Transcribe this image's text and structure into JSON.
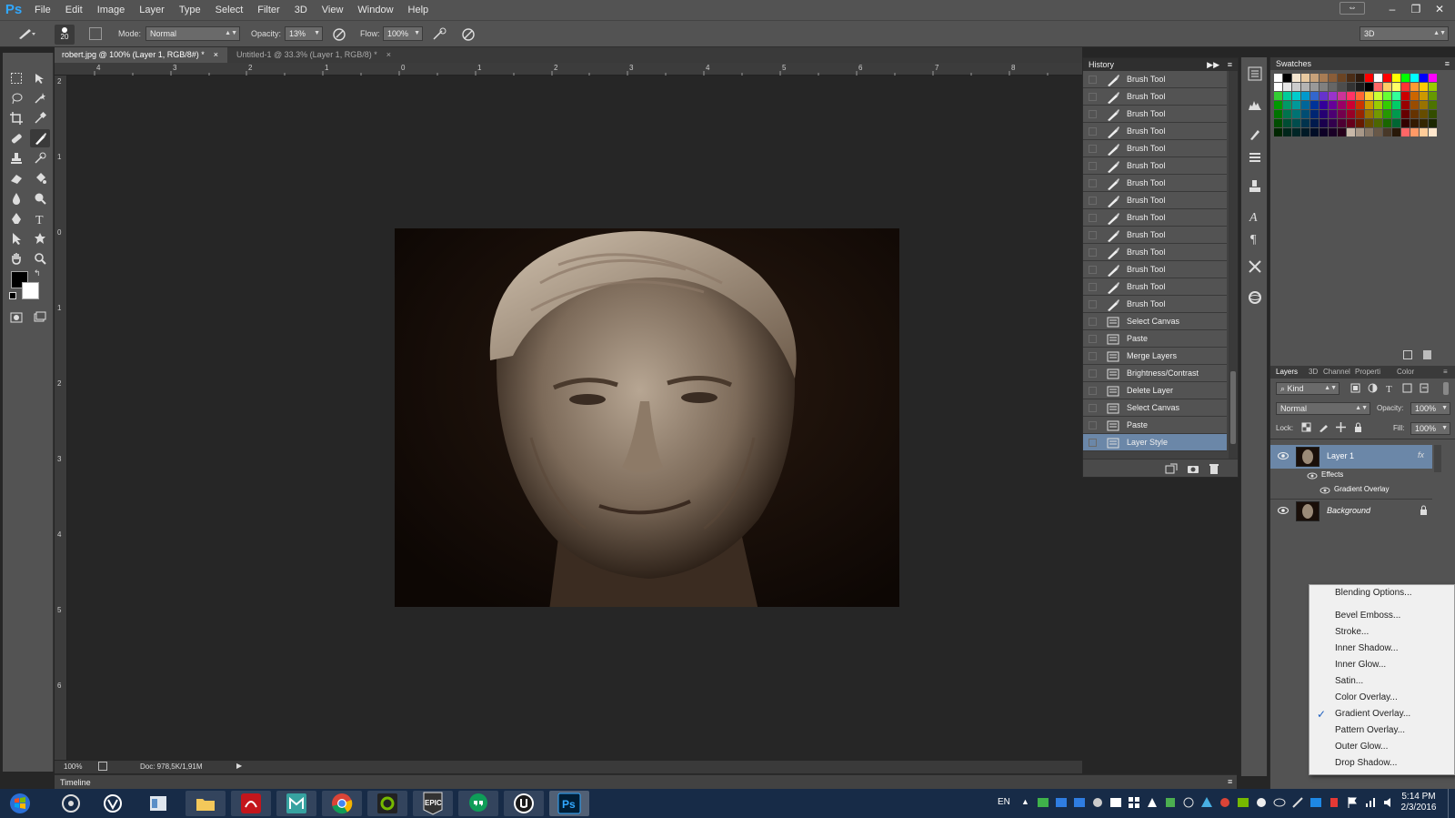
{
  "app": {
    "logo": "Ps"
  },
  "menu": [
    "File",
    "Edit",
    "Image",
    "Layer",
    "Type",
    "Select",
    "Filter",
    "3D",
    "View",
    "Window",
    "Help"
  ],
  "options": {
    "brush_size": "20",
    "mode_label": "Mode:",
    "mode_value": "Normal",
    "opacity_label": "Opacity:",
    "opacity_value": "13%",
    "flow_label": "Flow:",
    "flow_value": "100%",
    "workspace": "3D"
  },
  "tabs": [
    {
      "title": "robert.jpg @ 100% (Layer 1, RGB/8#) *",
      "close": "×"
    },
    {
      "title": "Untitled-1 @ 33.3% (Layer 1, RGB/8) *",
      "close": "×"
    }
  ],
  "ruler": {
    "h": [
      "4",
      "3",
      "2",
      "1",
      "0",
      "1",
      "2",
      "3",
      "4",
      "5",
      "6",
      "7",
      "8"
    ],
    "v": [
      "2",
      "1",
      "0",
      "1",
      "2",
      "3",
      "4",
      "5",
      "6"
    ]
  },
  "status": {
    "zoom": "100%",
    "doc": "Doc: 978,5K/1,91M"
  },
  "timeline": {
    "label": "Timeline"
  },
  "history": {
    "title": "History",
    "items": [
      {
        "label": "Brush Tool",
        "icon": "brush-icon"
      },
      {
        "label": "Brush Tool",
        "icon": "brush-icon"
      },
      {
        "label": "Brush Tool",
        "icon": "brush-icon"
      },
      {
        "label": "Brush Tool",
        "icon": "brush-icon"
      },
      {
        "label": "Brush Tool",
        "icon": "brush-icon"
      },
      {
        "label": "Brush Tool",
        "icon": "brush-icon"
      },
      {
        "label": "Brush Tool",
        "icon": "brush-icon"
      },
      {
        "label": "Brush Tool",
        "icon": "brush-icon"
      },
      {
        "label": "Brush Tool",
        "icon": "brush-icon"
      },
      {
        "label": "Brush Tool",
        "icon": "brush-icon"
      },
      {
        "label": "Brush Tool",
        "icon": "brush-icon"
      },
      {
        "label": "Brush Tool",
        "icon": "brush-icon"
      },
      {
        "label": "Brush Tool",
        "icon": "brush-icon"
      },
      {
        "label": "Brush Tool",
        "icon": "brush-icon"
      },
      {
        "label": "Select Canvas",
        "icon": "document-icon"
      },
      {
        "label": "Paste",
        "icon": "document-icon"
      },
      {
        "label": "Merge Layers",
        "icon": "document-icon"
      },
      {
        "label": "Brightness/Contrast",
        "icon": "document-icon"
      },
      {
        "label": "Delete Layer",
        "icon": "document-icon"
      },
      {
        "label": "Select Canvas",
        "icon": "document-icon"
      },
      {
        "label": "Paste",
        "icon": "document-icon"
      },
      {
        "label": "Layer Style",
        "icon": "document-icon",
        "selected": true
      }
    ]
  },
  "swatches": {
    "title": "Swatches",
    "colors": [
      "#ffffff",
      "#000000",
      "#f5e6d0",
      "#e8c9a0",
      "#c8a27a",
      "#a87c54",
      "#8a5d38",
      "#6b4423",
      "#4a2c15",
      "#2e1a0c",
      "#ff0000",
      "#ffffff",
      "#ff0000",
      "#ffff00",
      "#00ff00",
      "#00ffff",
      "#0000ff",
      "#ff00ff",
      "#ffffff",
      "#e6e6e6",
      "#cccccc",
      "#b3b3b3",
      "#999999",
      "#808080",
      "#666666",
      "#4d4d4d",
      "#333333",
      "#1a1a1a",
      "#000000",
      "#ff6666",
      "#ffcc66",
      "#ffff66",
      "#ff3333",
      "#ff9933",
      "#ffcc00",
      "#99cc00",
      "#33cc33",
      "#00cc99",
      "#00cccc",
      "#0099cc",
      "#3366cc",
      "#6633cc",
      "#9933cc",
      "#cc3399",
      "#ff3366",
      "#ff6633",
      "#ffcc33",
      "#ccff33",
      "#66ff33",
      "#33ff99",
      "#cc0000",
      "#cc6600",
      "#cc9900",
      "#669900",
      "#009900",
      "#009966",
      "#009999",
      "#006699",
      "#003399",
      "#330099",
      "#660099",
      "#990066",
      "#cc0033",
      "#cc3300",
      "#cc9900",
      "#99cc00",
      "#33cc00",
      "#00cc66",
      "#990000",
      "#994c00",
      "#997300",
      "#4d7300",
      "#007300",
      "#00734d",
      "#007373",
      "#004d73",
      "#002673",
      "#260073",
      "#4d0073",
      "#73004d",
      "#990026",
      "#992600",
      "#997300",
      "#739900",
      "#269900",
      "#00994d",
      "#660000",
      "#663300",
      "#664d00",
      "#334d00",
      "#004d00",
      "#004d33",
      "#004d4d",
      "#00334d",
      "#001a4d",
      "#1a004d",
      "#33004d",
      "#4d0033",
      "#66001a",
      "#661a00",
      "#664d00",
      "#4d6600",
      "#1a6600",
      "#006633",
      "#330000",
      "#331a00",
      "#332600",
      "#1a2600",
      "#002600",
      "#00261a",
      "#002626",
      "#001a26",
      "#000d26",
      "#0d0026",
      "#1a0026",
      "#26001a",
      "#c8b8a8",
      "#a89888",
      "#887868",
      "#685848",
      "#483828",
      "#281808",
      "#ff6666",
      "#ff9966",
      "#ffcc99",
      "#ffe6cc"
    ]
  },
  "layers": {
    "tabs": [
      "Layers",
      "3D",
      "Channel",
      "Properti",
      "Color"
    ],
    "kind_label": "Kind",
    "blend": "Normal",
    "opacity_label": "Opacity:",
    "opacity_value": "100%",
    "lock_label": "Lock:",
    "fill_label": "Fill:",
    "fill_value": "100%",
    "items": [
      {
        "name": "Layer 1",
        "fx": "fx",
        "selected": true
      },
      {
        "name": "Effects",
        "sub": true
      },
      {
        "name": "Gradient Overlay",
        "sub": true
      },
      {
        "name": "Background",
        "locked": true
      }
    ]
  },
  "context_menu": {
    "items": [
      {
        "label": "Blending Options..."
      },
      {
        "label": "Bevel  Emboss..."
      },
      {
        "label": "Stroke..."
      },
      {
        "label": "Inner Shadow..."
      },
      {
        "label": "Inner Glow..."
      },
      {
        "label": "Satin..."
      },
      {
        "label": "Color Overlay..."
      },
      {
        "label": "Gradient Overlay...",
        "checked": true
      },
      {
        "label": "Pattern Overlay..."
      },
      {
        "label": "Outer Glow..."
      },
      {
        "label": "Drop Shadow..."
      }
    ],
    "check": "✓"
  },
  "taskbar": {
    "lang": "EN",
    "time": "5:14 PM",
    "date": "2/3/2016",
    "apps": [
      "windows-start",
      "steam",
      "vray",
      "file-manager",
      "explorer",
      "acrobat",
      "maya",
      "chrome",
      "nvidia",
      "epic-games",
      "hangouts",
      "unreal",
      "photoshop"
    ],
    "epic_label": "EPIC",
    "ps_label": "Ps"
  }
}
